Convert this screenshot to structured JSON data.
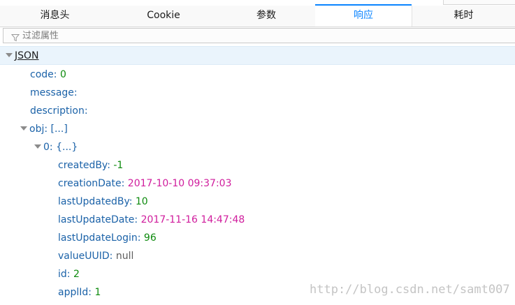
{
  "tabs": [
    {
      "label": "消息头",
      "selected": false
    },
    {
      "label": "Cookie",
      "selected": false
    },
    {
      "label": "参数",
      "selected": false
    },
    {
      "label": "响应",
      "selected": true
    },
    {
      "label": "耗时",
      "selected": false
    }
  ],
  "filter": {
    "placeholder": "过滤属性",
    "icon": "filter-icon"
  },
  "tree": {
    "root": "JSON",
    "rows": [
      {
        "key": "code",
        "value": "0",
        "type": "number"
      },
      {
        "key": "message",
        "value": "",
        "type": "string"
      },
      {
        "key": "description",
        "value": "",
        "type": "string"
      },
      {
        "key": "obj",
        "value": "[...]",
        "type": "array"
      },
      {
        "key": "0",
        "value": "{...}",
        "type": "object"
      },
      {
        "key": "createdBy",
        "value": "-1",
        "type": "number"
      },
      {
        "key": "creationDate",
        "value": "2017-10-10 09:37:03",
        "type": "string"
      },
      {
        "key": "lastUpdatedBy",
        "value": "10",
        "type": "number"
      },
      {
        "key": "lastUpdateDate",
        "value": "2017-11-16 14:47:48",
        "type": "string"
      },
      {
        "key": "lastUpdateLogin",
        "value": "96",
        "type": "number"
      },
      {
        "key": "valueUUID",
        "value": "null",
        "type": "null"
      },
      {
        "key": "id",
        "value": "2",
        "type": "number"
      },
      {
        "key": "applId",
        "value": "1",
        "type": "number"
      }
    ]
  },
  "watermark": "http://blog.csdn.net/samt007",
  "colors": {
    "accent": "#0a84ff",
    "key": "#1b62a8",
    "number": "#0d8a0d",
    "string": "#d01d9d",
    "null": "#5e5e5e"
  }
}
